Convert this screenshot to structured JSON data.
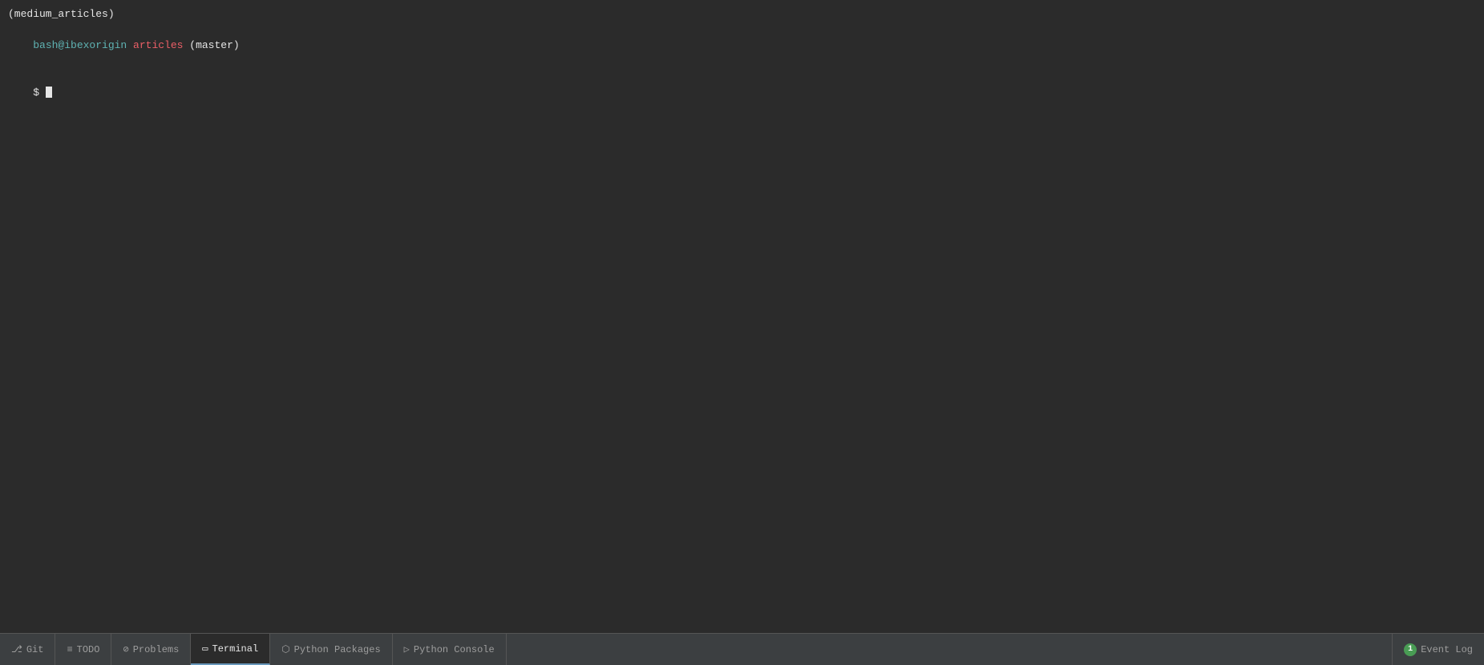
{
  "terminal": {
    "lines": [
      {
        "type": "context",
        "text": "(medium_articles)"
      },
      {
        "type": "prompt",
        "user": "bash@ibexorigin",
        "dir": " articles",
        "branch": " (master)"
      },
      {
        "type": "input",
        "dollar": "$ "
      }
    ]
  },
  "bottomBar": {
    "tabs": [
      {
        "id": "git",
        "label": "Git",
        "icon": "⎇",
        "active": false
      },
      {
        "id": "todo",
        "label": "TODO",
        "icon": "≡",
        "active": false
      },
      {
        "id": "problems",
        "label": "Problems",
        "icon": "⊘",
        "active": false
      },
      {
        "id": "terminal",
        "label": "Terminal",
        "icon": "▭",
        "active": true
      },
      {
        "id": "python-packages",
        "label": "Python Packages",
        "icon": "⬡",
        "active": false
      },
      {
        "id": "python-console",
        "label": "Python Console",
        "icon": "▷",
        "active": false
      }
    ],
    "eventLog": {
      "label": "Event Log",
      "count": "1"
    }
  }
}
